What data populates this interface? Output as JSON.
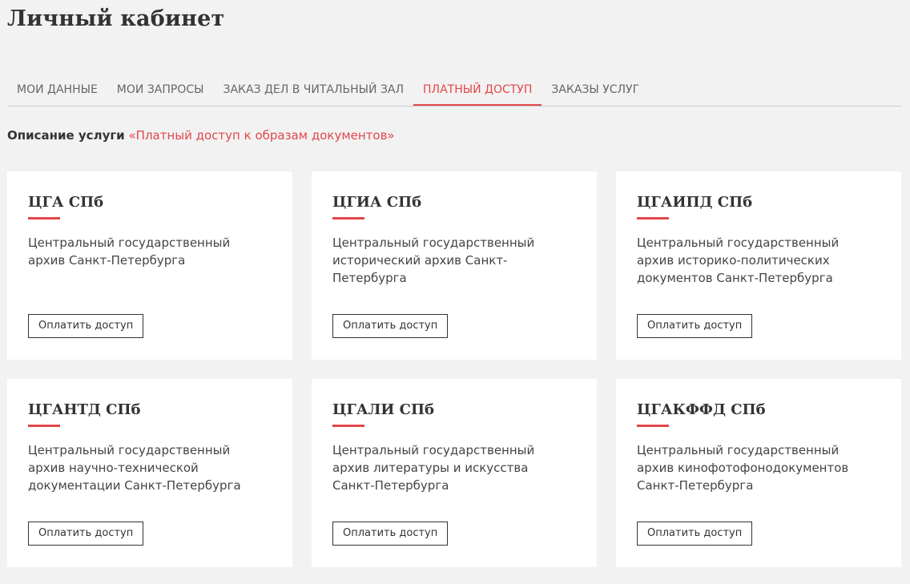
{
  "header": {
    "title": "Личный кабинет"
  },
  "tabs": [
    {
      "label": "МОИ ДАННЫЕ",
      "active": false
    },
    {
      "label": "МОИ ЗАПРОСЫ",
      "active": false
    },
    {
      "label": "ЗАКАЗ ДЕЛ В ЧИТАЛЬНЫЙ ЗАЛ",
      "active": false
    },
    {
      "label": "ПЛАТНЫЙ ДОСТУП",
      "active": true
    },
    {
      "label": "ЗАКАЗЫ УСЛУГ",
      "active": false
    }
  ],
  "service": {
    "label": "Описание услуги",
    "link": "«Платный доступ к образам документов»"
  },
  "cards": [
    {
      "title": "ЦГА СПб",
      "description": "Центральный государственный архив Санкт-Петербурга",
      "button": "Оплатить доступ"
    },
    {
      "title": "ЦГИА СПб",
      "description": "Центральный государственный исторический архив Санкт-Петербурга",
      "button": "Оплатить доступ"
    },
    {
      "title": "ЦГАИПД СПб",
      "description": "Центральный государственный архив историко-политических документов Санкт-Петербурга",
      "button": "Оплатить доступ"
    },
    {
      "title": "ЦГАНТД СПб",
      "description": "Центральный государственный архив научно-технической документации Санкт-Петербурга",
      "button": "Оплатить доступ"
    },
    {
      "title": "ЦГАЛИ СПб",
      "description": "Центральный государственный архив литературы и искусства Санкт-Петербурга",
      "button": "Оплатить доступ"
    },
    {
      "title": "ЦГАКФФД СПб",
      "description": "Центральный государственный архив кинофотофонодокументов Санкт-Петербурга",
      "button": "Оплатить доступ"
    }
  ],
  "colors": {
    "accent": "#e2474b",
    "background": "#f2f2f2",
    "card": "#ffffff",
    "text": "#333333"
  }
}
